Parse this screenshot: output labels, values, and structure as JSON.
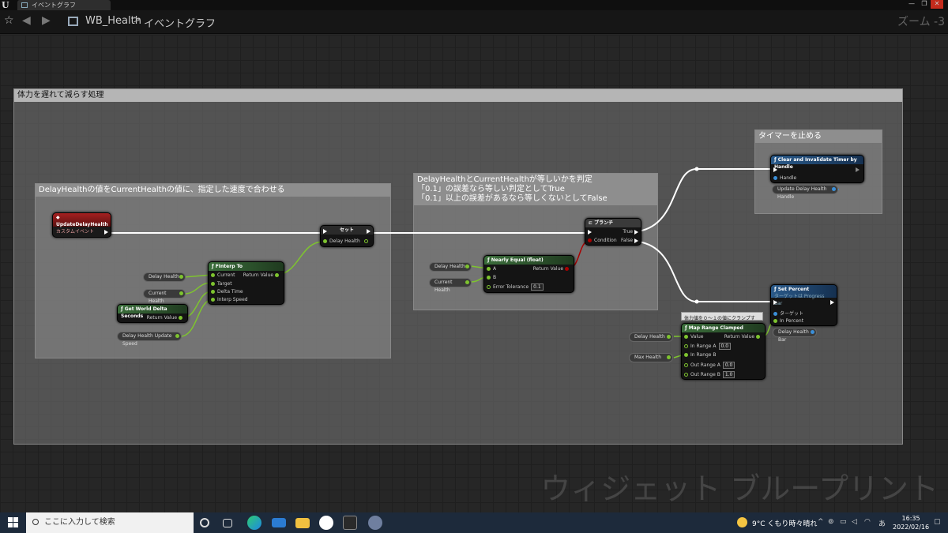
{
  "titlebar": {
    "tab_label": "イベントグラフ",
    "minimize": "—",
    "restore": "❐",
    "close": "✕"
  },
  "toolbar": {
    "breadcrumb_blueprint": "WB_Health",
    "breadcrumb_separator": ">",
    "breadcrumb_graph": "イベントグラフ",
    "zoom": "ズーム -3"
  },
  "comments": {
    "outer": "体力を遅れて減らす処理",
    "left": "DelayHealthの値をCurrentHealthの値に、指定した速度で合わせる",
    "middle": "DelayHealthとCurrentHealthが等しいかを判定\n「0.1」の誤差なら等しい判定としてTrue\n「0.1」以上の誤差があるなら等しくないとしてFalse",
    "timer": "タイマーを止める"
  },
  "nodes": {
    "custom_event": {
      "title": "UpdateDelayHealth",
      "subtitle": "カスタムイベント"
    },
    "finterp": {
      "title": "FInterp To",
      "pins": [
        "Current",
        "Target",
        "Delta Time",
        "Interp Speed"
      ],
      "out": "Return Value"
    },
    "world_delta": {
      "title": "Get World Delta Seconds",
      "out": "Return Value"
    },
    "set": {
      "title": "セット",
      "pin": "Delay Health"
    },
    "nearly_equal": {
      "title": "Nearly Equal (float)",
      "pin_a": "A",
      "pin_b": "B",
      "tolerance_label": "Error Tolerance",
      "tolerance": "0.1",
      "out": "Return Value"
    },
    "branch": {
      "title": "ブランチ",
      "condition": "Condition",
      "true": "True",
      "false": "False"
    },
    "clear_timer": {
      "title": "Clear and Invalidate Timer by Handle",
      "handle": "Handle"
    },
    "set_percent": {
      "title": "Set Percent",
      "subtitle": "ターゲットは Progress Bar",
      "target": "ターゲット",
      "in_percent": "In Percent"
    },
    "map_range": {
      "title": "Map Range Clamped",
      "tooltip": "体力値を０～１の値にクランプする。",
      "value": "Value",
      "in_a": "In Range A",
      "in_a_val": "0.0",
      "in_b": "In Range B",
      "out_a": "Out Range A",
      "out_a_val": "0.0",
      "out_b": "Out Range B",
      "out_b_val": "1.0",
      "out": "Return Value"
    }
  },
  "variables": {
    "delay_health_1": "Delay Health",
    "current_health_1": "Current Health",
    "delay_update_speed": "Delay Health Update Speed",
    "delay_health_2": "Delay Health",
    "current_health_2": "Current Health",
    "update_handle": "Update Delay Health Handle",
    "delay_health_3": "Delay Health",
    "max_health": "Max Health",
    "delay_health_bar": "Delay Health Bar"
  },
  "watermark": "ウィジェット ブループリント",
  "taskbar": {
    "search_placeholder": "ここに入力して検索",
    "weather": "9°C くもり時々晴れ",
    "ime": "あ",
    "time": "16:35",
    "date": "2022/02/16"
  },
  "colors": {
    "exec_wire": "#ffffff",
    "float_wire": "#7ec42f",
    "bool_wire": "#8b0000",
    "event_header": "#8a1a1a",
    "func_header": "#2f4f2f",
    "target_header": "#2a5a8a"
  }
}
